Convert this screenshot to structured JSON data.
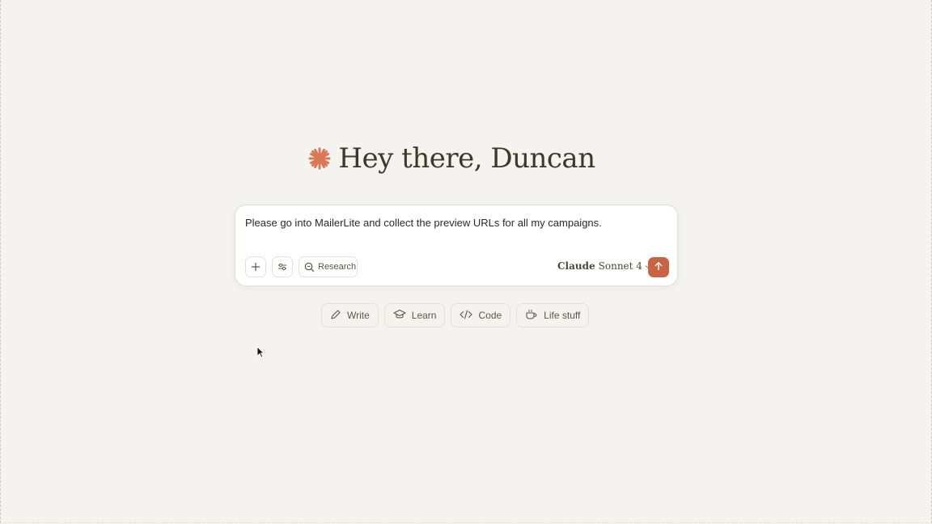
{
  "greeting": {
    "text": "Hey there, Duncan",
    "logo_icon": "claude-starburst-icon",
    "logo_color": "#d97757"
  },
  "composer": {
    "input_value": "Please go into MailerLite and collect the preview URLs for all my campaigns.",
    "buttons": {
      "add_icon": "plus-icon",
      "tools_icon": "sliders-icon",
      "research_label": "Research",
      "research_icon": "search-icon"
    },
    "model": {
      "brand": "Claude",
      "name": "Sonnet 4",
      "icon": "chevron-down-icon"
    },
    "send": {
      "icon": "arrow-up-icon",
      "color": "#c96442"
    }
  },
  "suggestions": [
    {
      "label": "Write",
      "icon": "pencil-icon"
    },
    {
      "label": "Learn",
      "icon": "graduation-cap-icon"
    },
    {
      "label": "Code",
      "icon": "code-icon"
    },
    {
      "label": "Life stuff",
      "icon": "coffee-cup-icon"
    }
  ],
  "colors": {
    "background": "#f5f3ef",
    "accent": "#c96442",
    "text": "#3d3929"
  }
}
